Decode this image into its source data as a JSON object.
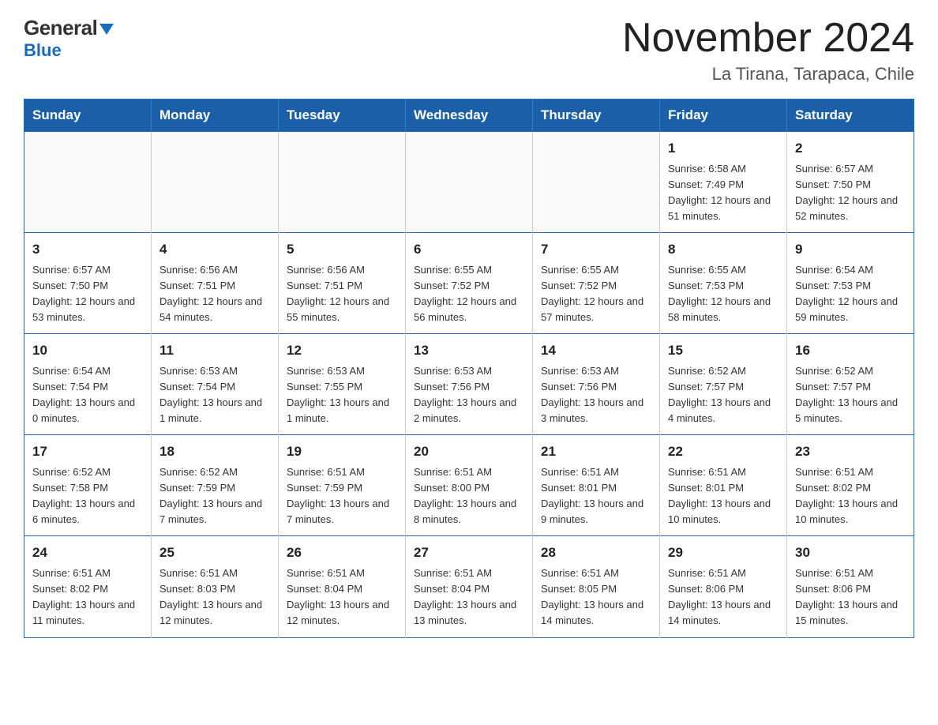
{
  "header": {
    "logo_general": "General",
    "logo_blue": "Blue",
    "title": "November 2024",
    "subtitle": "La Tirana, Tarapaca, Chile"
  },
  "calendar": {
    "weekdays": [
      "Sunday",
      "Monday",
      "Tuesday",
      "Wednesday",
      "Thursday",
      "Friday",
      "Saturday"
    ],
    "rows": [
      [
        {
          "day": "",
          "info": ""
        },
        {
          "day": "",
          "info": ""
        },
        {
          "day": "",
          "info": ""
        },
        {
          "day": "",
          "info": ""
        },
        {
          "day": "",
          "info": ""
        },
        {
          "day": "1",
          "info": "Sunrise: 6:58 AM\nSunset: 7:49 PM\nDaylight: 12 hours and 51 minutes."
        },
        {
          "day": "2",
          "info": "Sunrise: 6:57 AM\nSunset: 7:50 PM\nDaylight: 12 hours and 52 minutes."
        }
      ],
      [
        {
          "day": "3",
          "info": "Sunrise: 6:57 AM\nSunset: 7:50 PM\nDaylight: 12 hours and 53 minutes."
        },
        {
          "day": "4",
          "info": "Sunrise: 6:56 AM\nSunset: 7:51 PM\nDaylight: 12 hours and 54 minutes."
        },
        {
          "day": "5",
          "info": "Sunrise: 6:56 AM\nSunset: 7:51 PM\nDaylight: 12 hours and 55 minutes."
        },
        {
          "day": "6",
          "info": "Sunrise: 6:55 AM\nSunset: 7:52 PM\nDaylight: 12 hours and 56 minutes."
        },
        {
          "day": "7",
          "info": "Sunrise: 6:55 AM\nSunset: 7:52 PM\nDaylight: 12 hours and 57 minutes."
        },
        {
          "day": "8",
          "info": "Sunrise: 6:55 AM\nSunset: 7:53 PM\nDaylight: 12 hours and 58 minutes."
        },
        {
          "day": "9",
          "info": "Sunrise: 6:54 AM\nSunset: 7:53 PM\nDaylight: 12 hours and 59 minutes."
        }
      ],
      [
        {
          "day": "10",
          "info": "Sunrise: 6:54 AM\nSunset: 7:54 PM\nDaylight: 13 hours and 0 minutes."
        },
        {
          "day": "11",
          "info": "Sunrise: 6:53 AM\nSunset: 7:54 PM\nDaylight: 13 hours and 1 minute."
        },
        {
          "day": "12",
          "info": "Sunrise: 6:53 AM\nSunset: 7:55 PM\nDaylight: 13 hours and 1 minute."
        },
        {
          "day": "13",
          "info": "Sunrise: 6:53 AM\nSunset: 7:56 PM\nDaylight: 13 hours and 2 minutes."
        },
        {
          "day": "14",
          "info": "Sunrise: 6:53 AM\nSunset: 7:56 PM\nDaylight: 13 hours and 3 minutes."
        },
        {
          "day": "15",
          "info": "Sunrise: 6:52 AM\nSunset: 7:57 PM\nDaylight: 13 hours and 4 minutes."
        },
        {
          "day": "16",
          "info": "Sunrise: 6:52 AM\nSunset: 7:57 PM\nDaylight: 13 hours and 5 minutes."
        }
      ],
      [
        {
          "day": "17",
          "info": "Sunrise: 6:52 AM\nSunset: 7:58 PM\nDaylight: 13 hours and 6 minutes."
        },
        {
          "day": "18",
          "info": "Sunrise: 6:52 AM\nSunset: 7:59 PM\nDaylight: 13 hours and 7 minutes."
        },
        {
          "day": "19",
          "info": "Sunrise: 6:51 AM\nSunset: 7:59 PM\nDaylight: 13 hours and 7 minutes."
        },
        {
          "day": "20",
          "info": "Sunrise: 6:51 AM\nSunset: 8:00 PM\nDaylight: 13 hours and 8 minutes."
        },
        {
          "day": "21",
          "info": "Sunrise: 6:51 AM\nSunset: 8:01 PM\nDaylight: 13 hours and 9 minutes."
        },
        {
          "day": "22",
          "info": "Sunrise: 6:51 AM\nSunset: 8:01 PM\nDaylight: 13 hours and 10 minutes."
        },
        {
          "day": "23",
          "info": "Sunrise: 6:51 AM\nSunset: 8:02 PM\nDaylight: 13 hours and 10 minutes."
        }
      ],
      [
        {
          "day": "24",
          "info": "Sunrise: 6:51 AM\nSunset: 8:02 PM\nDaylight: 13 hours and 11 minutes."
        },
        {
          "day": "25",
          "info": "Sunrise: 6:51 AM\nSunset: 8:03 PM\nDaylight: 13 hours and 12 minutes."
        },
        {
          "day": "26",
          "info": "Sunrise: 6:51 AM\nSunset: 8:04 PM\nDaylight: 13 hours and 12 minutes."
        },
        {
          "day": "27",
          "info": "Sunrise: 6:51 AM\nSunset: 8:04 PM\nDaylight: 13 hours and 13 minutes."
        },
        {
          "day": "28",
          "info": "Sunrise: 6:51 AM\nSunset: 8:05 PM\nDaylight: 13 hours and 14 minutes."
        },
        {
          "day": "29",
          "info": "Sunrise: 6:51 AM\nSunset: 8:06 PM\nDaylight: 13 hours and 14 minutes."
        },
        {
          "day": "30",
          "info": "Sunrise: 6:51 AM\nSunset: 8:06 PM\nDaylight: 13 hours and 15 minutes."
        }
      ]
    ]
  }
}
